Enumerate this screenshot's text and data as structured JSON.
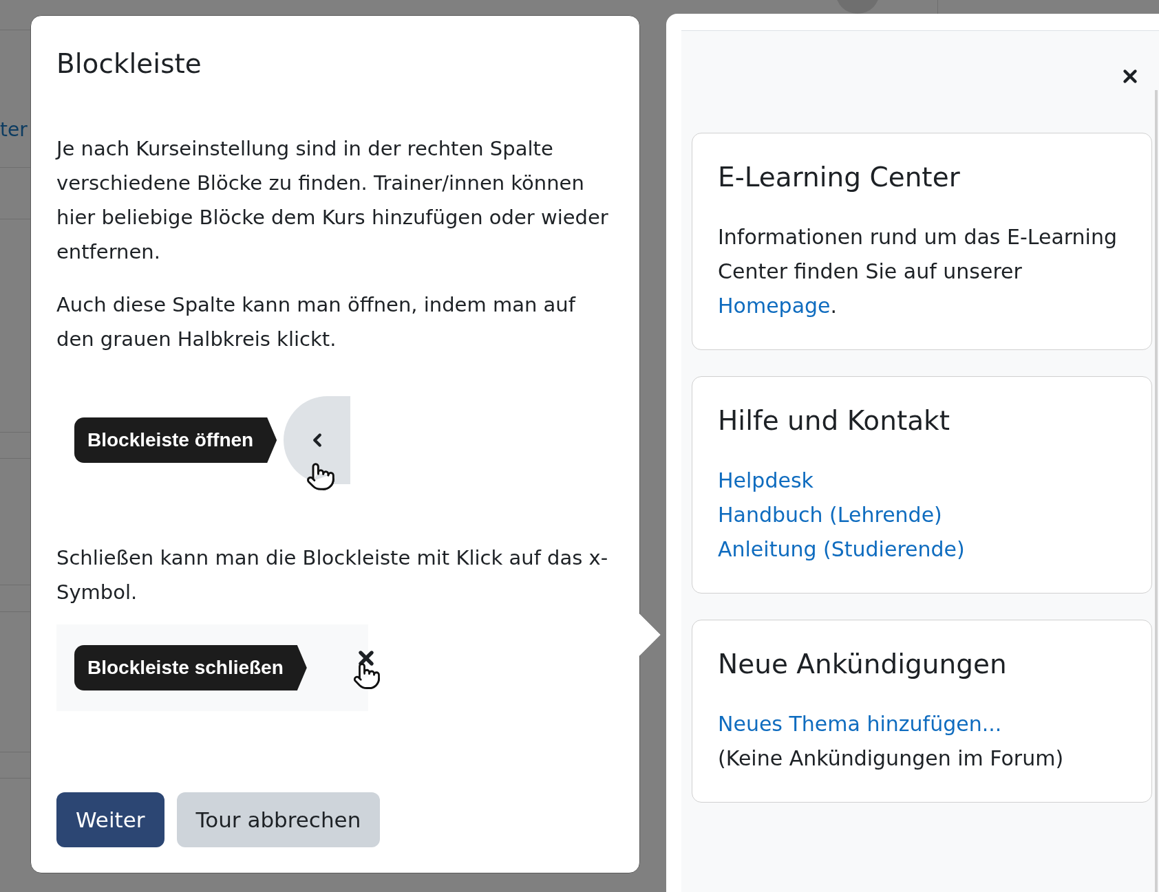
{
  "background_page": {
    "link_fragment": "ter"
  },
  "tour_step": {
    "title": "Blockleiste",
    "paragraphs": [
      "Je nach Kurseinstellung sind in der rechten Spalte verschiedene Blöcke zu finden. Trainer/innen können hier beliebige Blöcke dem Kurs hinzufügen oder wieder entfernen.",
      "Auch diese Spalte kann man öffnen, indem man auf den grauen Halbkreis klickt."
    ],
    "open_example": {
      "tooltip": "Blockleiste öffnen"
    },
    "close_paragraph": "Schließen kann man die Blockleiste mit Klick auf das x-Symbol.",
    "close_example": {
      "tooltip": "Blockleiste schließen"
    },
    "buttons": [
      {
        "label": "Weiter",
        "kind": "primary"
      },
      {
        "label": "Tour abbrechen",
        "kind": "secondary"
      }
    ]
  },
  "block_drawer": {
    "blocks": [
      {
        "title": "E-Learning Center",
        "lines": [
          {
            "kind": "sentence",
            "parts": [
              {
                "kind": "text",
                "text": "Informationen rund um das E-Learning Center finden Sie auf unserer "
              },
              {
                "kind": "link",
                "text": "Homepage"
              },
              {
                "kind": "text",
                "text": "."
              }
            ]
          }
        ]
      },
      {
        "title": "Hilfe und Kontakt",
        "lines": [
          {
            "kind": "link",
            "text": "Helpdesk"
          },
          {
            "kind": "link",
            "text": "Handbuch (Lehrende)"
          },
          {
            "kind": "link",
            "text": "Anleitung (Studierende)"
          }
        ]
      },
      {
        "title": "Neue Ankündigungen",
        "lines": [
          {
            "kind": "link",
            "text": "Neues Thema hinzufügen..."
          },
          {
            "kind": "text",
            "text": "(Keine Ankündigungen im Forum)"
          }
        ]
      }
    ]
  }
}
